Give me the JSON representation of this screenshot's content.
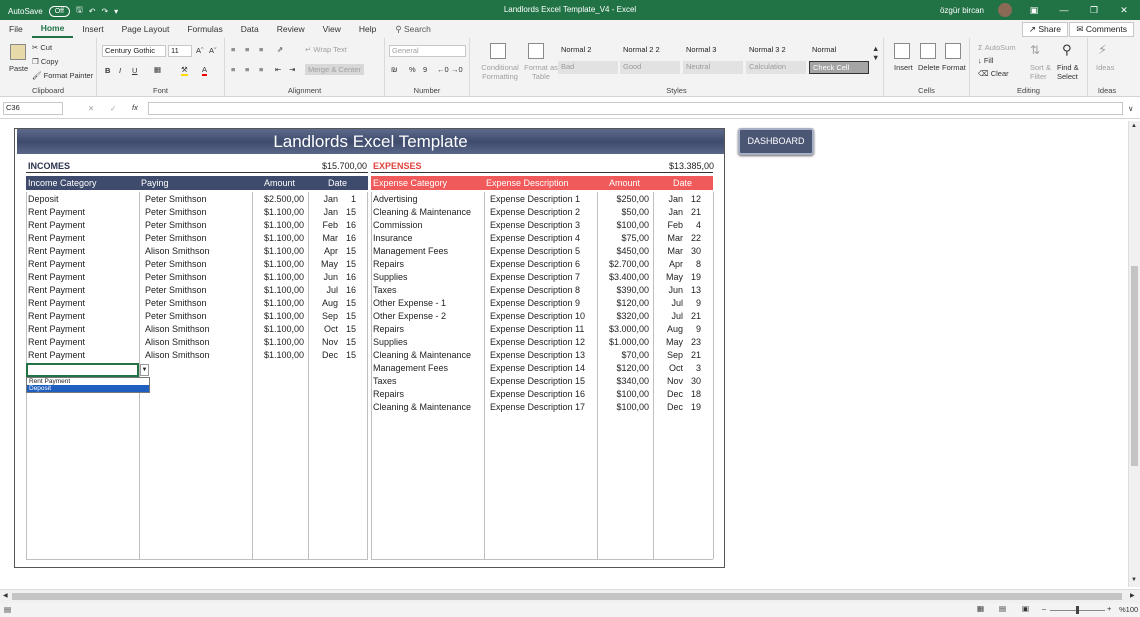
{
  "titlebar": {
    "autosave": "AutoSave",
    "toggle": "Off",
    "title": "Landlords Excel Template_V4  -  Excel",
    "user": "özgür bircan"
  },
  "tabs": [
    "File",
    "Home",
    "Insert",
    "Page Layout",
    "Formulas",
    "Data",
    "Review",
    "View",
    "Help"
  ],
  "search": "Search",
  "share": "Share",
  "comments": "Comments",
  "ribbon": {
    "clipboard": {
      "paste": "Paste",
      "cut": "Cut",
      "copy": "Copy",
      "painter": "Format Painter",
      "label": "Clipboard"
    },
    "font": {
      "name": "Century Gothic",
      "size": "11",
      "label": "Font"
    },
    "alignment": {
      "wrap": "Wrap Text",
      "merge": "Merge & Center",
      "label": "Alignment"
    },
    "number": {
      "format": "General",
      "label": "Number"
    },
    "styles": {
      "cond": "Conditional Formatting",
      "table": "Format as Table",
      "items": [
        "Normal 2",
        "Normal 2 2",
        "Normal 3",
        "Normal 3 2",
        "Normal",
        "Bad",
        "Good",
        "Neutral",
        "Calculation",
        "Check Cell"
      ],
      "label": "Styles"
    },
    "cells": {
      "insert": "Insert",
      "delete": "Delete",
      "format": "Format",
      "label": "Cells"
    },
    "editing": {
      "autosum": "AutoSum",
      "fill": "Fill",
      "clear": "Clear",
      "sort": "Sort & Filter",
      "find": "Find & Select",
      "label": "Editing"
    },
    "ideas": {
      "ideas": "Ideas",
      "label": "Ideas"
    }
  },
  "namebox": "C36",
  "banner": "Landlords Excel Template",
  "dashboard": "DASHBOARD",
  "incomes": {
    "title": "INCOMES",
    "total": "$15.700,00",
    "headers": [
      "Income Category",
      "Paying",
      "Amount",
      "Date"
    ],
    "rows": [
      [
        "Deposit",
        "Peter Smithson",
        "$2.500,00",
        "Jan",
        "1"
      ],
      [
        "Rent Payment",
        "Peter Smithson",
        "$1.100,00",
        "Jan",
        "15"
      ],
      [
        "Rent Payment",
        "Peter Smithson",
        "$1.100,00",
        "Feb",
        "16"
      ],
      [
        "Rent Payment",
        "Peter Smithson",
        "$1.100,00",
        "Mar",
        "16"
      ],
      [
        "Rent Payment",
        "Alison Smithson",
        "$1.100,00",
        "Apr",
        "15"
      ],
      [
        "Rent Payment",
        "Peter Smithson",
        "$1.100,00",
        "May",
        "15"
      ],
      [
        "Rent Payment",
        "Peter Smithson",
        "$1.100,00",
        "Jun",
        "16"
      ],
      [
        "Rent Payment",
        "Peter Smithson",
        "$1.100,00",
        "Jul",
        "16"
      ],
      [
        "Rent Payment",
        "Peter Smithson",
        "$1.100,00",
        "Aug",
        "15"
      ],
      [
        "Rent Payment",
        "Peter Smithson",
        "$1.100,00",
        "Sep",
        "15"
      ],
      [
        "Rent Payment",
        "Alison Smithson",
        "$1.100,00",
        "Oct",
        "15"
      ],
      [
        "Rent Payment",
        "Alison Smithson",
        "$1.100,00",
        "Nov",
        "15"
      ],
      [
        "Rent Payment",
        "Alison Smithson",
        "$1.100,00",
        "Dec",
        "15"
      ]
    ]
  },
  "dropdown": [
    "Rent Payment",
    "Deposit"
  ],
  "expenses": {
    "title": "EXPENSES",
    "total": "$13.385,00",
    "headers": [
      "Expense Category",
      "Expense Description",
      "Amount",
      "Date"
    ],
    "rows": [
      [
        "Advertising",
        "Expense Description 1",
        "$250,00",
        "Jan",
        "12"
      ],
      [
        "Cleaning & Maintenance",
        "Expense Description 2",
        "$50,00",
        "Jan",
        "21"
      ],
      [
        "Commission",
        "Expense Description 3",
        "$100,00",
        "Feb",
        "4"
      ],
      [
        "Insurance",
        "Expense Description 4",
        "$75,00",
        "Mar",
        "22"
      ],
      [
        "Management Fees",
        "Expense Description 5",
        "$450,00",
        "Mar",
        "30"
      ],
      [
        "Repairs",
        "Expense Description 6",
        "$2.700,00",
        "Apr",
        "8"
      ],
      [
        "Supplies",
        "Expense Description 7",
        "$3.400,00",
        "May",
        "19"
      ],
      [
        "Taxes",
        "Expense Description 8",
        "$390,00",
        "Jun",
        "13"
      ],
      [
        "Other Expense - 1",
        "Expense Description 9",
        "$120,00",
        "Jul",
        "9"
      ],
      [
        "Other Expense - 2",
        "Expense Description 10",
        "$320,00",
        "Jul",
        "21"
      ],
      [
        "Repairs",
        "Expense Description 11",
        "$3.000,00",
        "Aug",
        "9"
      ],
      [
        "Supplies",
        "Expense Description 12",
        "$1.000,00",
        "May",
        "23"
      ],
      [
        "Cleaning & Maintenance",
        "Expense Description 13",
        "$70,00",
        "Sep",
        "21"
      ],
      [
        "Management Fees",
        "Expense Description 14",
        "$120,00",
        "Oct",
        "3"
      ],
      [
        "Taxes",
        "Expense Description 15",
        "$340,00",
        "Nov",
        "30"
      ],
      [
        "Repairs",
        "Expense Description 16",
        "$100,00",
        "Dec",
        "18"
      ],
      [
        "Cleaning & Maintenance",
        "Expense Description 17",
        "$100,00",
        "Dec",
        "19"
      ]
    ]
  },
  "status": {
    "zoom": "%100"
  },
  "colors": {
    "excel_green": "#217346",
    "income_header": "#3e4b6c",
    "expense_header": "#f05a5a",
    "expense_title": "#e0453c"
  }
}
